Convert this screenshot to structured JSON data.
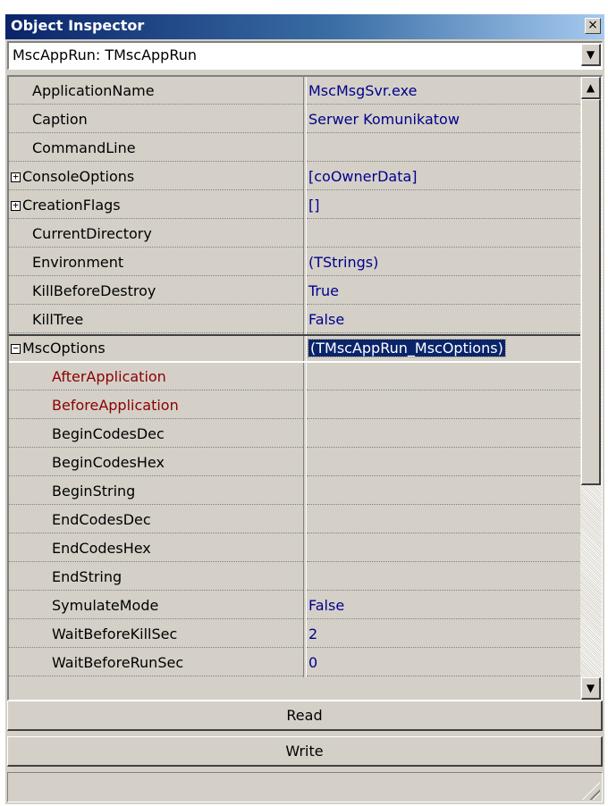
{
  "window": {
    "title": "Object Inspector",
    "close_glyph": "×"
  },
  "object_selector": {
    "value": "MscAppRun: TMscAppRun",
    "dropdown_glyph": "▼"
  },
  "properties": [
    {
      "name": "ApplicationName",
      "value": "MscMsgSvr.exe"
    },
    {
      "name": "Caption",
      "value": "Serwer Komunikatow"
    },
    {
      "name": "CommandLine",
      "value": ""
    },
    {
      "name": "ConsoleOptions",
      "value": "[coOwnerData]",
      "expander": "+"
    },
    {
      "name": "CreationFlags",
      "value": "[]",
      "expander": "+"
    },
    {
      "name": "CurrentDirectory",
      "value": ""
    },
    {
      "name": "Environment",
      "value": "(TStrings)"
    },
    {
      "name": "KillBeforeDestroy",
      "value": "True"
    },
    {
      "name": "KillTree",
      "value": "False"
    },
    {
      "name": "MscOptions",
      "value": "(TMscAppRun_MscOptions)",
      "expander": "−",
      "selected": true
    },
    {
      "name": "AfterApplication",
      "value": "",
      "sub": true,
      "event": true
    },
    {
      "name": "BeforeApplication",
      "value": "",
      "sub": true,
      "event": true
    },
    {
      "name": "BeginCodesDec",
      "value": "",
      "sub": true
    },
    {
      "name": "BeginCodesHex",
      "value": "",
      "sub": true
    },
    {
      "name": "BeginString",
      "value": "",
      "sub": true
    },
    {
      "name": "EndCodesDec",
      "value": "",
      "sub": true
    },
    {
      "name": "EndCodesHex",
      "value": "",
      "sub": true
    },
    {
      "name": "EndString",
      "value": "",
      "sub": true
    },
    {
      "name": "SymulateMode",
      "value": "False",
      "sub": true
    },
    {
      "name": "WaitBeforeKillSec",
      "value": "2",
      "sub": true
    },
    {
      "name": "WaitBeforeRunSec",
      "value": "0",
      "sub": true
    }
  ],
  "scrollbar": {
    "up_glyph": "▲",
    "down_glyph": "▼"
  },
  "buttons": {
    "read": "Read",
    "write": "Write"
  },
  "colors": {
    "title_start": "#0a246a",
    "title_end": "#a6caf0",
    "value_text": "#00008b",
    "event_text": "#8b0000",
    "face": "#d4d0c8"
  }
}
